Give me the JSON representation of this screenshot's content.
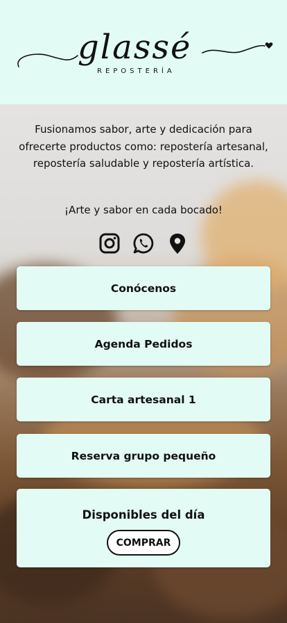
{
  "brand": {
    "name": "glassé",
    "subtitle": "REPOSTERÍA"
  },
  "intro": {
    "description": "Fusionamos sabor, arte y dedicación para ofrecerte productos como: repostería artesanal, repostería saludable y repostería artística.",
    "tagline": "¡Arte y sabor en cada bocado!"
  },
  "socials": [
    {
      "icon": "instagram-icon"
    },
    {
      "icon": "whatsapp-icon"
    },
    {
      "icon": "location-pin-icon"
    }
  ],
  "links": [
    {
      "label": "Conócenos"
    },
    {
      "label": "Agenda Pedidos"
    },
    {
      "label": "Carta artesanal 1"
    },
    {
      "label": "Reserva grupo pequeño"
    }
  ],
  "featured": {
    "title": "Disponibles del día",
    "button": "COMPRAR"
  },
  "colors": {
    "header_bg": "#e3fbf5",
    "button_bg": "#e3fbf5",
    "text": "#111111"
  }
}
